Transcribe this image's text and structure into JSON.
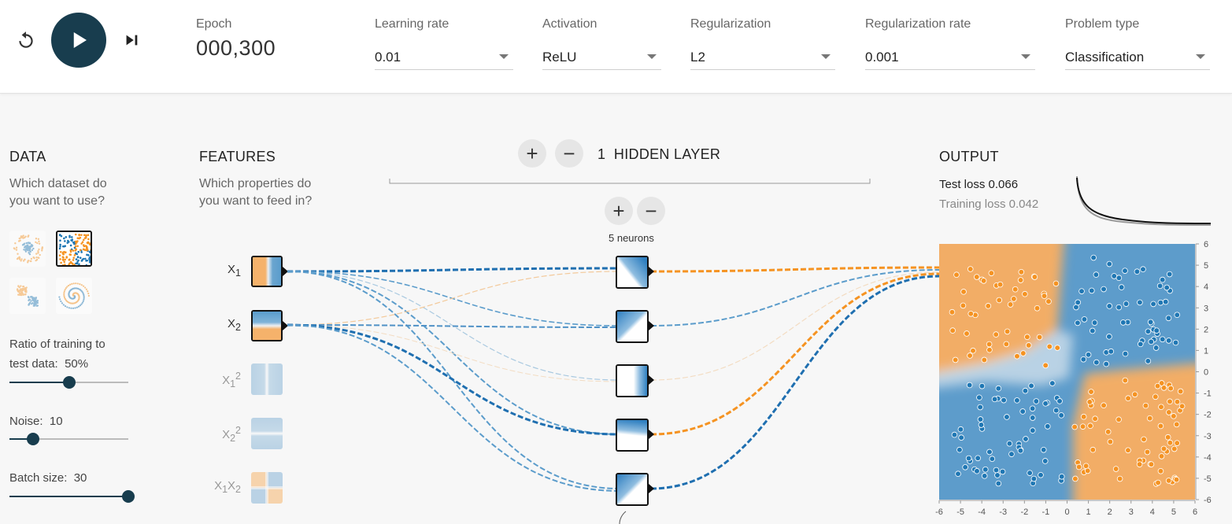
{
  "toolbar": {
    "epoch_label": "Epoch",
    "epoch_value": "000,300",
    "learning_rate": {
      "label": "Learning rate",
      "value": "0.01"
    },
    "activation": {
      "label": "Activation",
      "value": "ReLU"
    },
    "regularization": {
      "label": "Regularization",
      "value": "L2"
    },
    "regularization_rate": {
      "label": "Regularization rate",
      "value": "0.001"
    },
    "problem_type": {
      "label": "Problem type",
      "value": "Classification"
    },
    "icons": {
      "reset": "reset-icon",
      "play": "play-icon",
      "step": "step-forward-icon"
    }
  },
  "data_panel": {
    "title": "DATA",
    "subtitle_1": "Which dataset do",
    "subtitle_2": "you want to use?",
    "datasets": [
      "circle",
      "xor",
      "gaussian",
      "spiral"
    ],
    "selected_dataset": "xor",
    "ratio": {
      "label": "Ratio of training to",
      "label2": "test data:",
      "value": "50%",
      "fraction": 0.5
    },
    "noise": {
      "label": "Noise:",
      "value": "10",
      "fraction": 0.2
    },
    "batch": {
      "label": "Batch size:",
      "value": "30",
      "fraction": 1.0
    }
  },
  "features_panel": {
    "title": "FEATURES",
    "subtitle_1": "Which properties do",
    "subtitle_2": "you want to feed in?",
    "features": [
      {
        "name": "X",
        "sub": "1",
        "sup": "",
        "active": true
      },
      {
        "name": "X",
        "sub": "2",
        "sup": "",
        "active": true
      },
      {
        "name": "X",
        "sub": "1",
        "sup": "2",
        "active": false
      },
      {
        "name": "X",
        "sub": "2",
        "sup": "2",
        "active": false
      },
      {
        "name": "X",
        "sub": "1",
        "sup": "",
        "name2": "X",
        "sub2": "2",
        "active": false
      }
    ]
  },
  "hidden": {
    "count": "1",
    "label": "HIDDEN LAYER",
    "neurons_label": "5 neurons"
  },
  "output": {
    "title": "OUTPUT",
    "test_loss": "Test loss 0.066",
    "training_loss": "Training loss 0.042",
    "x_ticks": [
      "-6",
      "-5",
      "-4",
      "-3",
      "-2",
      "-1",
      "0",
      "1",
      "2",
      "3",
      "4",
      "5",
      "6"
    ],
    "y_ticks": [
      "6",
      "5",
      "4",
      "3",
      "2",
      "1",
      "0",
      "-1",
      "-2",
      "-3",
      "-4",
      "-5",
      "-6"
    ]
  },
  "colors": {
    "blue": "#1f77b4",
    "orange": "#f59322",
    "dark": "#183d4e"
  }
}
